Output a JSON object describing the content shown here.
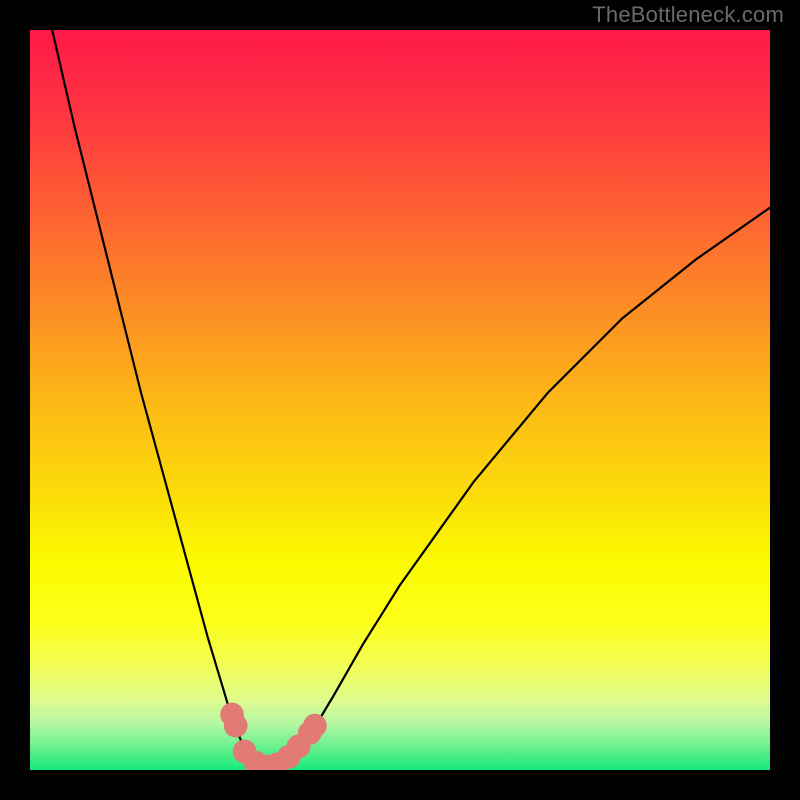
{
  "attribution": "TheBottleneck.com",
  "chart_data": {
    "type": "line",
    "title": "",
    "xlabel": "",
    "ylabel": "",
    "xlim": [
      0,
      100
    ],
    "ylim": [
      0,
      100
    ],
    "series": [
      {
        "name": "bottleneck-curve",
        "x": [
          3,
          6,
          9,
          12,
          15,
          18,
          21,
          24,
          27,
          28.5,
          30,
          31.5,
          33,
          34.5,
          36,
          38,
          41,
          45,
          50,
          55,
          60,
          65,
          70,
          75,
          80,
          85,
          90,
          95,
          100
        ],
        "y": [
          100,
          87,
          75,
          63,
          51,
          40,
          29,
          18,
          8,
          4,
          1.5,
          0.5,
          0.5,
          1,
          2.5,
          5,
          10,
          17,
          25,
          32,
          39,
          45,
          51,
          56,
          61,
          65,
          69,
          72.5,
          76
        ]
      }
    ],
    "markers": {
      "name": "highlight-segments",
      "points": [
        {
          "x": 27.3,
          "y": 7.5
        },
        {
          "x": 27.8,
          "y": 6.0
        },
        {
          "x": 29.0,
          "y": 2.5
        },
        {
          "x": 30.5,
          "y": 1.0
        },
        {
          "x": 32.0,
          "y": 0.5
        },
        {
          "x": 33.5,
          "y": 0.8
        },
        {
          "x": 35.0,
          "y": 1.8
        },
        {
          "x": 36.3,
          "y": 3.2
        },
        {
          "x": 37.8,
          "y": 5.0
        },
        {
          "x": 38.5,
          "y": 6.0
        }
      ],
      "color": "#e17a74",
      "radius_pct": 1.6
    },
    "background_gradient": {
      "stops": [
        {
          "offset": 0.0,
          "color": "#fe1948"
        },
        {
          "offset": 0.12,
          "color": "#fe3740"
        },
        {
          "offset": 0.25,
          "color": "#fd6331"
        },
        {
          "offset": 0.38,
          "color": "#fc8e24"
        },
        {
          "offset": 0.5,
          "color": "#fcb716"
        },
        {
          "offset": 0.63,
          "color": "#fbdd09"
        },
        {
          "offset": 0.72,
          "color": "#fbfb01"
        },
        {
          "offset": 0.8,
          "color": "#feff19"
        },
        {
          "offset": 0.86,
          "color": "#f2fd57"
        },
        {
          "offset": 0.905,
          "color": "#dffb8d"
        },
        {
          "offset": 0.935,
          "color": "#b9f7a3"
        },
        {
          "offset": 0.96,
          "color": "#7ff294"
        },
        {
          "offset": 0.98,
          "color": "#4bee87"
        },
        {
          "offset": 1.0,
          "color": "#17ea7a"
        }
      ]
    }
  }
}
